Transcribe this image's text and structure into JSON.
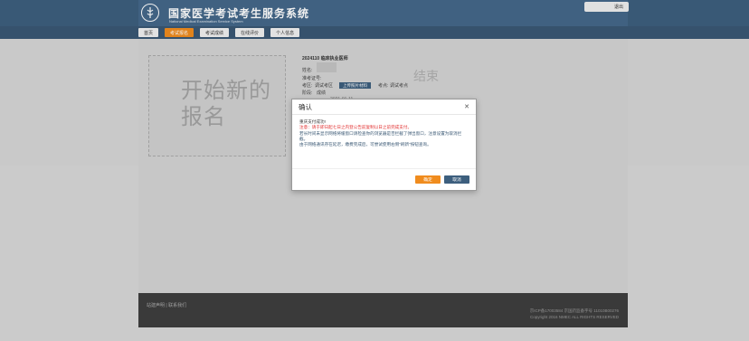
{
  "header": {
    "title": "国家医学考试考生服务系统",
    "subtitle": "National Medical Examination Service System",
    "logout_label": "退出"
  },
  "nav": {
    "items": [
      {
        "label": "首页",
        "active": false
      },
      {
        "label": "考试报名",
        "active": true
      },
      {
        "label": "考试成绩",
        "active": false
      },
      {
        "label": "在线评价",
        "active": false
      },
      {
        "label": "个人信息",
        "active": false
      }
    ]
  },
  "main": {
    "banner_text": "开始新的报名",
    "end_text": "结束",
    "exam_title": "2024110 临床执业医师",
    "name_label": "姓名:",
    "id_label": "准考证号:",
    "region_label": "考区:",
    "region_value": "调试考区",
    "submit_label": "上传照片材料",
    "site_label": "考点:",
    "site_value": "调试考点",
    "status_label": "阶段:",
    "status_value": "成绩",
    "date_text": "· 2021-01-11"
  },
  "dialog": {
    "title": "确认",
    "line1": "重庆支付成功!",
    "warn": "注意：请于即日起七日之内登公告前复制以日之前完成支付。",
    "line3": "若长时间未显示网络将缓窗口请检查你的浏览器是否拦截了弹出窗口，注意设置为取消拦截。",
    "line4": "由于网络通讯存在延迟，缴费完成后，可尝试使用右侧\"刷新\"按钮查询。",
    "ok_label": "确定",
    "cancel_label": "取消"
  },
  "footer": {
    "left_text": "站建声明 | 联系我们",
    "right_line1": "京ICP备17003584 京国药监备字号 11010B00276",
    "right_line2": "Copyright 2016 NMEC ALL RIGHTS RESERVED"
  },
  "colors": {
    "header_bg": "#3d5f7e",
    "accent": "#f08c1e",
    "warn": "#e12d2d"
  }
}
